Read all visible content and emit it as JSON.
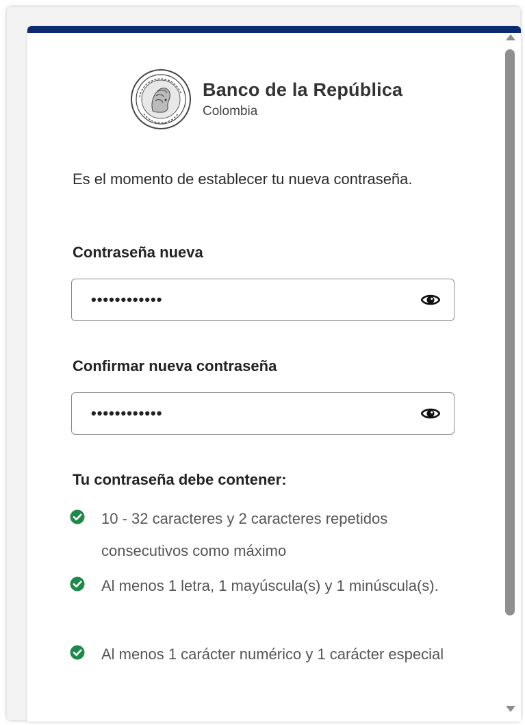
{
  "brand": {
    "name": "Banco de la República",
    "country": "Colombia"
  },
  "intro": "Es el momento de establecer tu nueva contraseña.",
  "form": {
    "new_password": {
      "label": "Contraseña nueva",
      "value": "••••••••••••"
    },
    "confirm_password": {
      "label": "Confirmar nueva contraseña",
      "value": "••••••••••••"
    }
  },
  "requirements": {
    "title": "Tu contraseña debe contener:",
    "items": [
      {
        "text": "10 - 32 caracteres y 2 caracteres repetidos consecutivos como máximo",
        "met": true
      },
      {
        "text": "Al menos 1 letra, 1 mayúscula(s) y 1 minúscula(s).",
        "met": true
      },
      {
        "text": "Al menos 1 carácter numérico y 1 carácter especial",
        "met": true
      }
    ]
  },
  "icons": {
    "show_password": "eye-icon",
    "requirement_met": "check-circle-icon"
  },
  "colors": {
    "accent_bar": "#0b2a6f",
    "check_green": "#1e8a4a"
  }
}
